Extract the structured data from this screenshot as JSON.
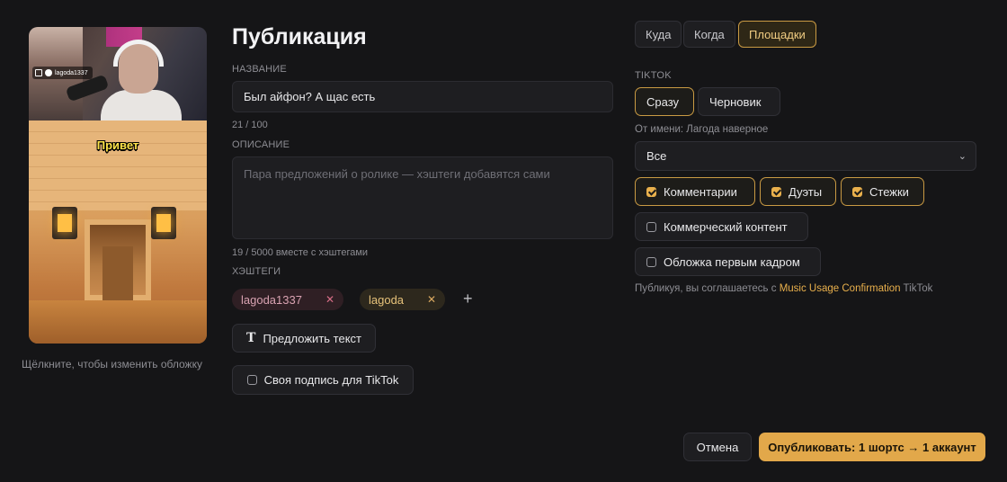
{
  "cover": {
    "overlay_handle": "lagoda1337",
    "overlay_caption": "Привет",
    "hint": "Щёлкните, чтобы изменить обложку"
  },
  "form": {
    "title": "Публикация",
    "name_label": "НАЗВАНИЕ",
    "name_value": "Был айфон? А щас есть",
    "name_counter": "21 / 100",
    "description_label": "ОПИСАНИЕ",
    "description_placeholder": "Пара предложений о ролике — хэштеги добавятся сами",
    "description_counter": "19 / 5000 вместе с хэштегами",
    "hashtags_label": "ХЭШТЕГИ",
    "hashtags": [
      {
        "text": "lagoda1337",
        "remove": "✕"
      },
      {
        "text": "lagoda",
        "remove": "✕"
      }
    ],
    "add_tag": "+",
    "suggest_button": "Предложить текст",
    "own_caption_button": "Своя подпись для TikTok"
  },
  "tabs": [
    "Куда",
    "Когда",
    "Площадки"
  ],
  "active_tab": "Площадки",
  "tiktok": {
    "section_label": "TIKTOK",
    "mode_options": [
      "Сразу",
      "Черновик"
    ],
    "active_mode": "Сразу",
    "from_label": "От имени: Лагода наверное",
    "privacy_value": "Все",
    "privacy_chevron": "⌄",
    "toggles": [
      {
        "label": "Комментарии",
        "checked": true
      },
      {
        "label": "Дуэты",
        "checked": true
      },
      {
        "label": "Стежки",
        "checked": true
      },
      {
        "label": "Коммерческий контент",
        "checked": false
      },
      {
        "label": "Обложка первым кадром",
        "checked": false
      }
    ],
    "agreement_prefix": "Публикуя, вы соглашаетесь с ",
    "agreement_link": "Music Usage Confirmation",
    "agreement_suffix": " TikTok"
  },
  "footer": {
    "cancel": "Отмена",
    "publish": "Опубликовать: 1 шортс → 1 аккаунт"
  },
  "colors": {
    "accent": "#e2a84a",
    "background": "#151517"
  }
}
